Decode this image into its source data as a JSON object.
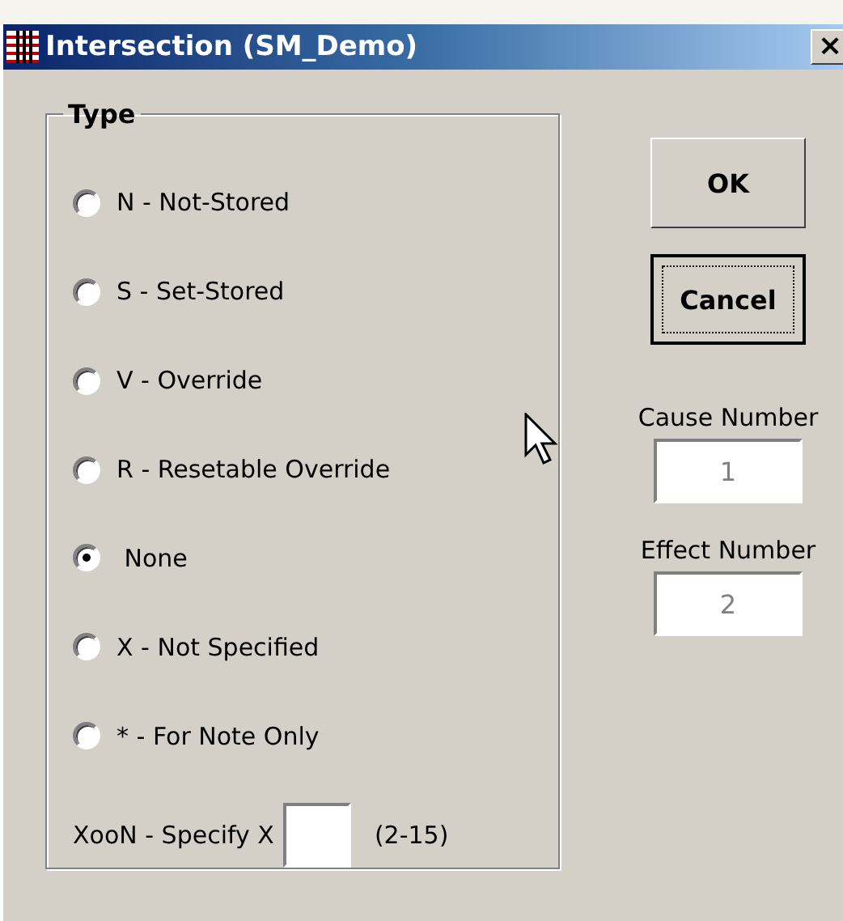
{
  "window": {
    "title": "Intersection (SM_Demo)",
    "close": "×"
  },
  "type_group": {
    "title": "Type",
    "options": [
      {
        "label": "N - Not-Stored",
        "selected": false
      },
      {
        "label": "S - Set-Stored",
        "selected": false
      },
      {
        "label": "V - Override",
        "selected": false
      },
      {
        "label": "R - Resetable Override",
        "selected": false
      },
      {
        "label": " None",
        "selected": true
      },
      {
        "label": "X - Not Specified",
        "selected": false
      },
      {
        "label": "* - For Note Only",
        "selected": false
      }
    ],
    "xoon": {
      "label": "XooN - Specify X",
      "range": "(2-15)"
    }
  },
  "buttons": [
    {
      "label": "OK",
      "focused": false
    },
    {
      "label": "Cancel",
      "focused": true
    }
  ],
  "cause_number": {
    "label": "Cause Number",
    "value": "1",
    "disabled": true
  },
  "effect_number": {
    "label": "Effect Number",
    "value": "2",
    "disabled": true
  }
}
